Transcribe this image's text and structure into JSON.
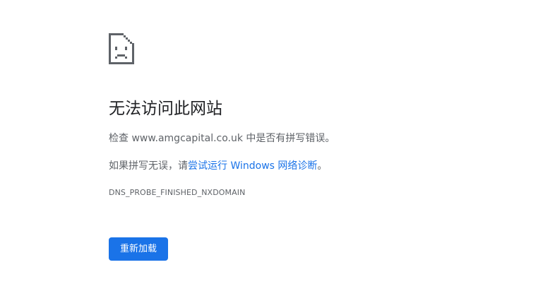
{
  "error": {
    "icon": "sad-document-icon",
    "title": "无法访问此网站",
    "check_prefix": "检查 ",
    "domain": "www.amgcapital.co.uk",
    "check_suffix": " 中是否有拼写错误。",
    "hint_prefix": "如果拼写无误，请",
    "hint_link": "尝试运行 Windows 网络诊断",
    "hint_suffix": "。",
    "code": "DNS_PROBE_FINISHED_NXDOMAIN"
  },
  "actions": {
    "reload_label": "重新加载"
  },
  "colors": {
    "accent": "#1a73e8",
    "text_primary": "#202124",
    "text_secondary": "#5f6368",
    "icon": "#5f6368"
  }
}
